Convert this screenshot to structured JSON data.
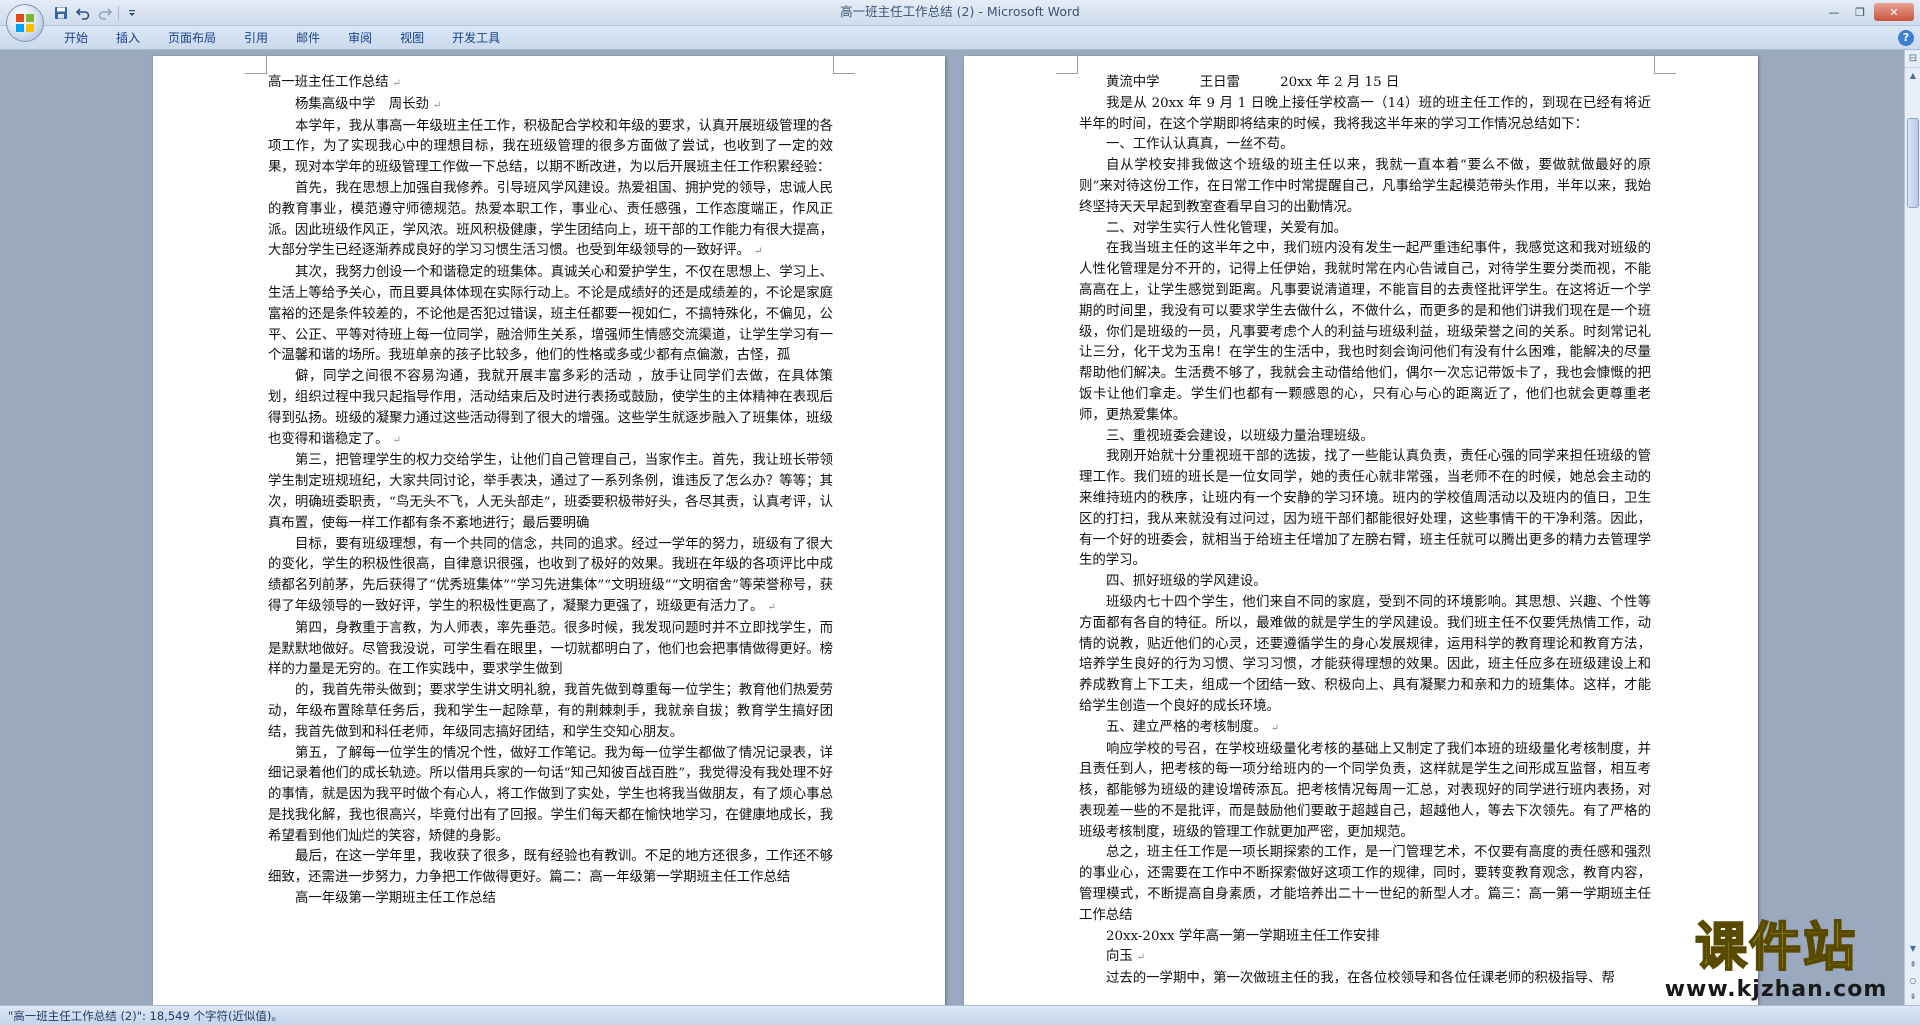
{
  "window": {
    "title_doc": "高一班主任工作总结 (2)",
    "title_sep": " - ",
    "title_app": "Microsoft Word",
    "min_glyph": "—",
    "max_glyph": "❐",
    "close_glyph": "✕"
  },
  "qat": {
    "save_icon": "floppy-disk",
    "undo_icon": "undo-arrow",
    "redo_icon": "redo-arrow",
    "customize_icon": "dropdown-arrow"
  },
  "ribbon": {
    "tabs": [
      "开始",
      "插入",
      "页面布局",
      "引用",
      "邮件",
      "审阅",
      "视图",
      "开发工具"
    ],
    "help_glyph": "?"
  },
  "left_page": {
    "paragraphs": [
      {
        "text": "高一班主任工作总结",
        "indent": false,
        "mark": "↵"
      },
      {
        "text": "杨集高级中学　周长劲",
        "indent": true,
        "mark": "↵"
      },
      {
        "text": "本学年，我从事高一年级班主任工作，积极配合学校和年级的要求，认真开展班级管理的各项工作，为了实现我心中的理想目标，我在班级管理的很多方面做了尝试，也收到了一定的效果，现对本学年的班级管理工作做一下总结，以期不断改进，为以后开展班主任工作积累经验：",
        "indent": true,
        "mark": ""
      },
      {
        "text": "首先，我在思想上加强自我修养。引导班风学风建设。热爱祖国、拥护党的领导，忠诚人民的教育事业，模范遵守师德规范。热爱本职工作，事业心、责任感强，工作态度端正，作风正派。因此班级作风正，学风浓。班风积极健康，学生团结向上，班干部的工作能力有很大提高，大部分学生已经逐渐养成良好的学习习惯生活习惯。也受到年级领导的一致好评。",
        "indent": true,
        "mark": "↵"
      },
      {
        "text": "其次，我努力创设一个和谐稳定的班集体。真诚关心和爱护学生，不仅在思想上、学习上、生活上等给予关心，而且要具体体现在实际行动上。不论是成绩好的还是成绩差的，不论是家庭富裕的还是条件较差的，不论他是否犯过错误，班主任都要一视如仁，不搞特殊化，不偏见，公平、公正、平等对待班上每一位同学，融洽师生关系，增强师生情感交流渠道，让学生学习有一个温馨和谐的场所。我班单亲的孩子比较多，他们的性格或多或少都有点偏激，古怪，孤",
        "indent": true,
        "mark": ""
      },
      {
        "text": "僻，同学之间很不容易沟通，我就开展丰富多彩的活动 ，放手让同学们去做，在具体策划，组织过程中我只起指导作用，活动结束后及时进行表扬或鼓励，使学生的主体精神在表现后得到弘扬。班级的凝聚力通过这些活动得到了很大的增强。这些学生就逐步融入了班集体，班级也变得和谐稳定了。",
        "indent": true,
        "mark": "↵"
      },
      {
        "text": "第三，把管理学生的权力交给学生，让他们自己管理自己，当家作主。首先，我让班长带领学生制定班规班纪，大家共同讨论，举手表决，通过了一系列条例，谁违反了怎么办？等等；其次，明确班委职责，“鸟无头不飞，人无头部走”，班委要积极带好头，各尽其责，认真考评，认真布置，使每一样工作都有条不紊地进行；最后要明确",
        "indent": true,
        "mark": ""
      },
      {
        "text": "目标，要有班级理想，有一个共同的信念，共同的追求。经过一学年的努力，班级有了很大的变化，学生的积极性很高，自律意识很强，也收到了极好的效果。我班在年级的各项评比中成绩都名列前茅，先后获得了“优秀班集体”“学习先进集体”“文明班级”“文明宿舍”等荣誉称号，获得了年级领导的一致好评，学生的积极性更高了，凝聚力更强了，班级更有活力了。",
        "indent": true,
        "mark": "↵"
      },
      {
        "text": "第四，身教重于言教，为人师表，率先垂范。很多时候，我发现问题时并不立即找学生，而是默默地做好。尽管我没说，可学生看在眼里，一切就都明白了，他们也会把事情做得更好。榜样的力量是无穷的。在工作实践中，要求学生做到",
        "indent": true,
        "mark": ""
      },
      {
        "text": "的，我首先带头做到；要求学生讲文明礼貌，我首先做到尊重每一位学生；教育他们热爱劳动，年级布置除草任务后，我和学生一起除草，有的荆棘刺手，我就亲自拔；教育学生搞好团结，我首先做到和科任老师，年级同志搞好团结，和学生交知心朋友。",
        "indent": true,
        "mark": ""
      },
      {
        "text": "第五，了解每一位学生的情况个性，做好工作笔记。我为每一位学生都做了情况记录表，详细记录着他们的成长轨迹。所以借用兵家的一句话“知己知彼百战百胜”，我觉得没有我处理不好的事情，就是因为我平时做个有心人，将工作做到了实处，学生也将我当做朋友，有了烦心事总是找我化解，我也很高兴，毕竟付出有了回报。学生们每天都在愉快地学习，在健康地成长，我希望看到他们灿烂的笑容，矫健的身影。",
        "indent": true,
        "mark": ""
      },
      {
        "text": "最后，在这一学年里，我收获了很多，既有经验也有教训。不足的地方还很多，工作还不够细致，还需进一步努力，力争把工作做得更好。篇二：高一年级第一学期班主任工作总结",
        "indent": true,
        "mark": ""
      },
      {
        "text": "高一年级第一学期班主任工作总结",
        "indent": true,
        "mark": ""
      }
    ]
  },
  "right_page": {
    "paragraphs": [
      {
        "text": "黄流中学　　　王日雷　　　20xx 年 2 月 15 日",
        "indent": true,
        "mark": ""
      },
      {
        "text": "我是从 20xx 年 9 月 1 日晚上接任学校高一（14）班的班主任工作的，到现在已经有将近半年的时间，在这个学期即将结束的时候，我将我这半年来的学习工作情况总结如下：",
        "indent": true,
        "mark": ""
      },
      {
        "text": "一、工作认认真真，一丝不苟。",
        "indent": true,
        "mark": ""
      },
      {
        "text": "自从学校安排我做这个班级的班主任以来，我就一直本着“要么不做，要做就做最好的原则”来对待这份工作，在日常工作中时常提醒自己，凡事给学生起模范带头作用，半年以来，我始终坚持天天早起到教室查看早自习的出勤情况。",
        "indent": true,
        "mark": ""
      },
      {
        "text": "二、对学生实行人性化管理，关爱有加。",
        "indent": true,
        "mark": ""
      },
      {
        "text": "在我当班主任的这半年之中，我们班内没有发生一起严重违纪事件，我感觉这和我对班级的人性化管理是分不开的，记得上任伊始，我就时常在内心告诫自己，对待学生要分类而视，不能高高在上，让学生感觉到距离。凡事要说清道理，不能盲目的去责怪批评学生。在这将近一个学期的时间里，我没有可以要求学生去做什么，不做什么，而更多的是和他们讲我们现在是一个班级，你们是班级的一员，凡事要考虑个人的利益与班级利益，班级荣誉之间的关系。时刻常记礼让三分，化干戈为玉帛！在学生的生活中，我也时刻会询问他们有没有什么困难，能解决的尽量帮助他们解决。生活费不够了，我就会主动借给他们，偶尔一次忘记带饭卡了，我也会慷慨的把饭卡让他们拿走。学生们也都有一颗感恩的心，只有心与心的距离近了，他们也就会更尊重老师，更热爱集体。",
        "indent": true,
        "mark": ""
      },
      {
        "text": "三、重视班委会建设，以班级力量治理班级。",
        "indent": true,
        "mark": ""
      },
      {
        "text": "我刚开始就十分重视班干部的选拔，找了一些能认真负责，责任心强的同学来担任班级的管理工作。我们班的班长是一位女同学，她的责任心就非常强，当老师不在的时候，她总会主动的来维持班内的秩序，让班内有一个安静的学习环境。班内的学校值周活动以及班内的值日，卫生区的打扫，我从来就没有过问过，因为班干部们都能很好处理，这些事情干的干净利落。因此，有一个好的班委会，就相当于给班主任增加了左膀右臂，班主任就可以腾出更多的精力去管理学生的学习。",
        "indent": true,
        "mark": ""
      },
      {
        "text": "四、抓好班级的学风建设。",
        "indent": true,
        "mark": ""
      },
      {
        "text": "班级内七十四个学生，他们来自不同的家庭，受到不同的环境影响。其思想、兴趣、个性等方面都有各自的特征。所以，最难做的就是学生的学风建设。我们班主任不仅要凭热情工作，动情的说教，贴近他们的心灵，还要遵循学生的身心发展规律，运用科学的教育理论和教育方法，培养学生良好的行为习惯、学习习惯，才能获得理想的效果。因此，班主任应多在班级建设上和养成教育上下工夫，组成一个团结一致、积极向上、具有凝聚力和亲和力的班集体。这样，才能给学生创造一个良好的成长环境。",
        "indent": true,
        "mark": ""
      },
      {
        "text": "五、建立严格的考核制度。",
        "indent": true,
        "mark": "↵"
      },
      {
        "text": "响应学校的号召，在学校班级量化考核的基础上又制定了我们本班的班级量化考核制度，并且责任到人，把考核的每一项分给班内的一个同学负责，这样就是学生之间形成互监督，相互考核，都能够为班级的建设增砖添瓦。把考核情况每周一汇总，对表现好的同学进行班内表扬，对表现差一些的不是批评，而是鼓励他们要敢于超越自己，超越他人，等去下次领先。有了严格的班级考核制度，班级的管理工作就更加严密，更加规范。",
        "indent": true,
        "mark": ""
      },
      {
        "text": "总之，班主任工作是一项长期探索的工作，是一门管理艺术，不仅要有高度的责任感和强烈的事业心，还需要在工作中不断探索做好这项工作的规律，同时，要转变教育观念，教育内容，管理模式，不断提高自身素质，才能培养出二十一世纪的新型人才。篇三：高一第一学期班主任工作总结",
        "indent": true,
        "mark": ""
      },
      {
        "text": "20xx-20xx 学年高一第一学期班主任工作安排",
        "indent": true,
        "mark": ""
      },
      {
        "text": "向玉",
        "indent": true,
        "mark": "↵"
      },
      {
        "text": "过去的一学期中，第一次做班主任的我，在各位校领导和各位任课老师的积极指导、帮",
        "indent": true,
        "mark": ""
      }
    ]
  },
  "status": {
    "text": "\"高一班主任工作总结 (2)\": 18,549 个字符(近似值)。"
  },
  "watermark": {
    "cn": "课件站",
    "url": "www.kjzhan.com"
  },
  "scrollbar": {
    "up_glyph": "▲",
    "down_glyph": "▼",
    "ruler_glyph": "⊟",
    "prev_glyph": "⇞",
    "browse_glyph": "○",
    "next_glyph": "⇟"
  }
}
